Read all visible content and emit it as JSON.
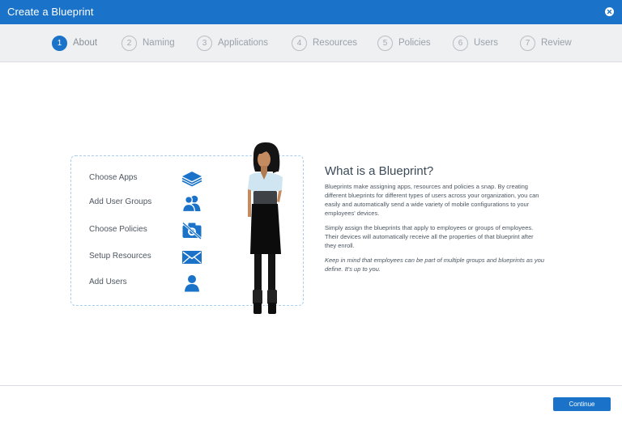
{
  "window": {
    "title": "Create a Blueprint"
  },
  "steps": [
    {
      "num": "1",
      "label": "About",
      "active": true
    },
    {
      "num": "2",
      "label": "Naming"
    },
    {
      "num": "3",
      "label": "Applications"
    },
    {
      "num": "4",
      "label": "Resources"
    },
    {
      "num": "5",
      "label": "Policies"
    },
    {
      "num": "6",
      "label": "Users"
    },
    {
      "num": "7",
      "label": "Review"
    }
  ],
  "features": [
    {
      "label": "Choose Apps",
      "icon": "layers-icon"
    },
    {
      "label": "Add User Groups",
      "icon": "user-group-icon"
    },
    {
      "label": "Choose Policies",
      "icon": "camera-disabled-icon"
    },
    {
      "label": "Setup Resources",
      "icon": "envelope-icon"
    },
    {
      "label": "Add Users",
      "icon": "user-icon"
    }
  ],
  "about": {
    "heading": "What is a Blueprint?",
    "p1": "Blueprints make assigning apps, resources and policies a snap. By creating different blueprints for different types of users across your organization, you can easily and automatically send a wide variety of mobile configurations to your employees' devices.",
    "p2": "Simply assign the blueprints that apply to employees or groups of employees. Their devices will automatically receive all the properties of that blueprint after they enroll.",
    "p3": "Keep in mind that employees can be part of multiple groups and blueprints as you define. It's up to you."
  },
  "footer": {
    "continue_label": "Continue"
  },
  "colors": {
    "accent": "#1a73c9",
    "icon": "#1a73c9",
    "step_bar": "#eef0f2"
  }
}
